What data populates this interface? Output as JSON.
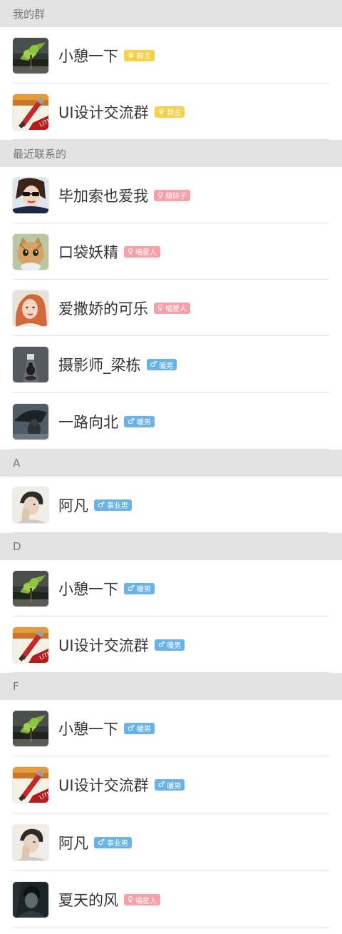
{
  "sections": [
    {
      "title": "我的群",
      "items": [
        {
          "name": "小憩一下",
          "badge": "群主",
          "badge_type": "yellow",
          "badge_icon": "crown-icon",
          "avatar": "nature-tree-avatar"
        },
        {
          "name": "UI设计交流群",
          "badge": "群主",
          "badge_type": "yellow",
          "badge_icon": "crown-icon",
          "avatar": "paint-brush-app-avatar"
        }
      ]
    },
    {
      "title": "最近联系的",
      "items": [
        {
          "name": "毕加索也爱我",
          "badge": "萌妹子",
          "badge_type": "pink",
          "badge_icon": "female-icon",
          "avatar": "woman-sunglasses-avatar"
        },
        {
          "name": "口袋妖精",
          "badge": "喵星人",
          "badge_type": "pink",
          "badge_icon": "female-icon",
          "avatar": "kitten-avatar"
        },
        {
          "name": "爱撒娇的可乐",
          "badge": "喵星人",
          "badge_type": "pink",
          "badge_icon": "female-icon",
          "avatar": "red-hair-girl-avatar"
        },
        {
          "name": "摄影师_梁栋",
          "badge": "暖男",
          "badge_type": "blue",
          "badge_icon": "male-icon",
          "avatar": "tunnel-figure-avatar"
        },
        {
          "name": "一路向北",
          "badge": "暖男",
          "badge_type": "blue",
          "badge_icon": "male-icon",
          "avatar": "umbrella-avatar"
        }
      ]
    },
    {
      "title": "A",
      "items": [
        {
          "name": "阿凡",
          "badge": "事业男",
          "badge_type": "blue",
          "badge_icon": "male-icon",
          "avatar": "man-hand-face-avatar"
        }
      ]
    },
    {
      "title": "D",
      "items": [
        {
          "name": "小憩一下",
          "badge": "暖男",
          "badge_type": "blue",
          "badge_icon": "male-icon",
          "avatar": "nature-tree-avatar"
        },
        {
          "name": "UI设计交流群",
          "badge": "暖男",
          "badge_type": "blue",
          "badge_icon": "male-icon",
          "avatar": "paint-brush-app-avatar"
        }
      ]
    },
    {
      "title": "F",
      "items": [
        {
          "name": "小憩一下",
          "badge": "暖男",
          "badge_type": "blue",
          "badge_icon": "male-icon",
          "avatar": "nature-tree-avatar"
        },
        {
          "name": "UI设计交流群",
          "badge": "暖男",
          "badge_type": "blue",
          "badge_icon": "male-icon",
          "avatar": "paint-brush-app-avatar"
        },
        {
          "name": "阿凡",
          "badge": "事业男",
          "badge_type": "blue",
          "badge_icon": "male-icon",
          "avatar": "man-hand-face-avatar"
        },
        {
          "name": "夏天的风",
          "badge": "喵星人",
          "badge_type": "pink",
          "badge_icon": "female-icon",
          "avatar": "dark-portrait-avatar"
        }
      ]
    }
  ],
  "colors": {
    "header_bg": "#e3e3e3",
    "yellow_badge": "#f7d14a",
    "pink_badge": "#f6a0a8",
    "blue_badge": "#69b3ea"
  }
}
